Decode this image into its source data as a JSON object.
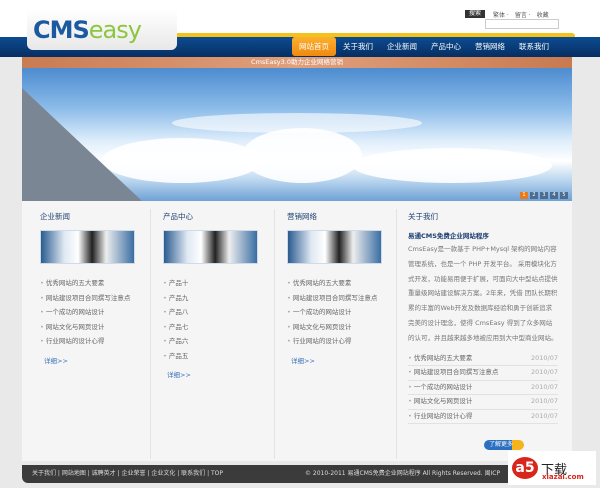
{
  "header": {
    "logo_cms": "CMS",
    "logo_easy": "easy",
    "search_button": "搜索",
    "top_links": [
      "繁体 ·",
      "留言 ·",
      "收藏"
    ]
  },
  "nav": [
    "网站首页",
    "关于我们",
    "企业新闻",
    "产品中心",
    "营销网络",
    "联系我们"
  ],
  "banner": {
    "strip_text": "CmsEasy3.0助力企业网络营销",
    "slides": [
      "1",
      "2",
      "3",
      "4",
      "5"
    ]
  },
  "columns": [
    {
      "title": "企业新闻",
      "items": [
        "优秀网站的五大要素",
        "网站建设项目合同撰写注意点",
        "一个成功的网站设计",
        "网站文化与网页设计",
        "行业网站的设计心得"
      ],
      "more": "详细>>"
    },
    {
      "title": "产品中心",
      "items": [
        "产品十",
        "产品九",
        "产品八",
        "产品七",
        "产品六",
        "产品五"
      ],
      "more": "详细>>"
    },
    {
      "title": "营销网络",
      "items": [
        "优秀网站的五大要素",
        "网站建设项目合同撰写注意点",
        "一个成功的网站设计",
        "网站文化与网页设计",
        "行业网站的设计心得"
      ],
      "more": "详细>>"
    }
  ],
  "about": {
    "title": "关于我们",
    "subtitle": "易通CMS免费企业网站程序",
    "text": "CmsEasy是一款基于 PHP+Mysql 架构的网站内容管理系统，也是一个 PHP 开发平台。 采用模块化方式开发，功能易用便于扩展，可面向大中型站点提供重量级网站建设解决方案。2年来，凭借 团队长期积累的丰富的Web开发及数据库经验和勇于创新追求完美的设计理念，使得 CmsEasy 得到了众多网站的认可，并且越来越多地被应用到大中型商业网站。",
    "items": [
      {
        "t": "优秀网站的五大要素",
        "d": "2010/07"
      },
      {
        "t": "网站建设项目合同撰写注意点",
        "d": "2010/07"
      },
      {
        "t": "一个成功的网站设计",
        "d": "2010/07"
      },
      {
        "t": "网站文化与网页设计",
        "d": "2010/07"
      },
      {
        "t": "行业网站的设计心得",
        "d": "2010/07"
      }
    ],
    "more_button": "了解更多"
  },
  "footer": {
    "links": "关于我们 | 网站地图 | 诚聘英才 | 企业荣誉 | 企业文化 | 联系我们 | TOP",
    "copyright": "© 2010-2011 易通CMS免费企业网站程序 All Rights Reserved. 闽ICP"
  },
  "watermark": {
    "logo": "a5",
    "text": "下载",
    "site": "xiazai.com"
  }
}
